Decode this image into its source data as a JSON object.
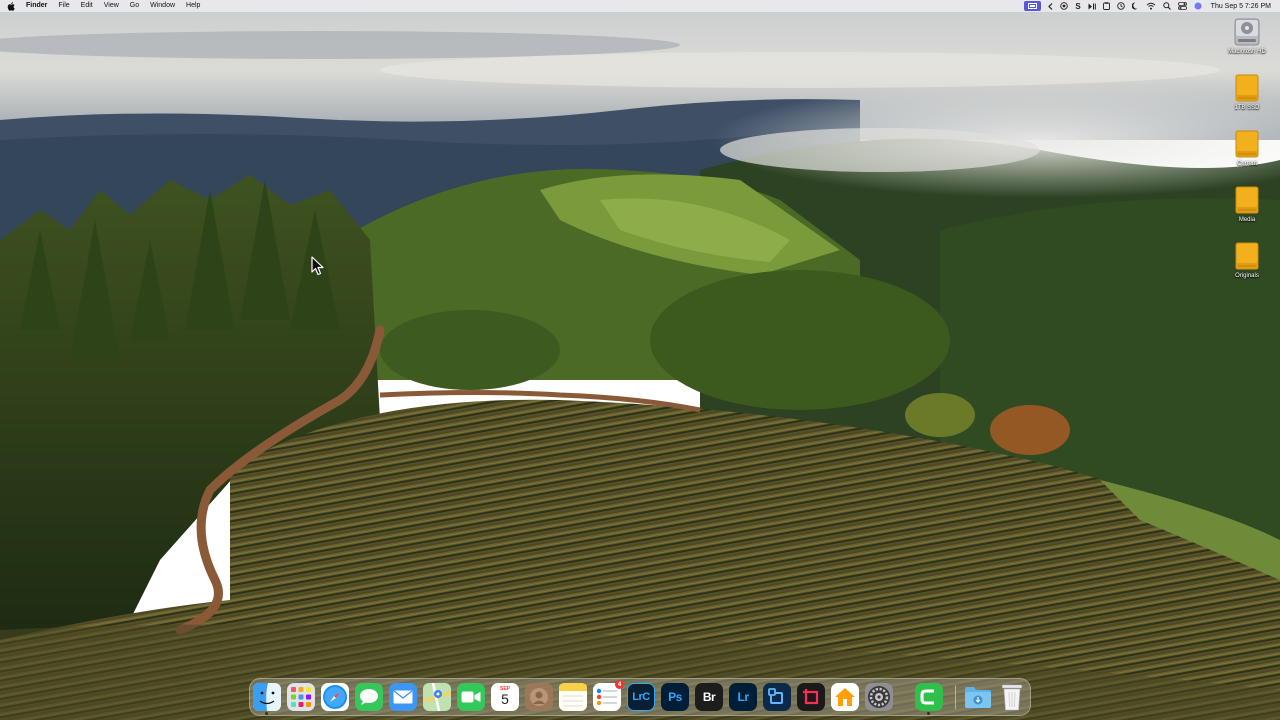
{
  "menubar": {
    "app_name": "Finder",
    "menus": [
      "File",
      "Edit",
      "View",
      "Go",
      "Window",
      "Help"
    ],
    "clock": "Thu Sep 5  7:26 PM",
    "tray_icons": [
      "screen-mirroring-icon",
      "back-chevron-icon",
      "record-icon",
      "skype-s-icon",
      "play-pause-icon",
      "clipboard-icon",
      "clock-history-icon",
      "focus-moon-icon",
      "wifi-icon",
      "search-icon",
      "control-center-icon",
      "siri-icon"
    ]
  },
  "desktop_icons": [
    {
      "label": "Macintosh HD",
      "icon": "hard-drive-icon"
    },
    {
      "label": "1TB SSD",
      "icon": "external-drive-icon"
    },
    {
      "label": "Current",
      "icon": "external-drive-icon"
    },
    {
      "label": "Media",
      "icon": "external-drive-icon"
    },
    {
      "label": "Originals",
      "icon": "external-drive-icon"
    }
  ],
  "dock": {
    "apps": [
      {
        "name": "Finder",
        "icon": "finder-icon"
      },
      {
        "name": "Launchpad",
        "icon": "launchpad-icon"
      },
      {
        "name": "Safari",
        "icon": "safari-icon"
      },
      {
        "name": "Messages",
        "icon": "messages-icon"
      },
      {
        "name": "Mail",
        "icon": "mail-icon"
      },
      {
        "name": "Maps",
        "icon": "maps-icon"
      },
      {
        "name": "FaceTime",
        "icon": "facetime-icon"
      },
      {
        "name": "Calendar",
        "icon": "calendar-icon",
        "month": "SEP",
        "day": "5"
      },
      {
        "name": "Contacts",
        "icon": "contacts-icon"
      },
      {
        "name": "Notes",
        "icon": "notes-icon"
      },
      {
        "name": "Reminders",
        "icon": "reminders-icon",
        "badge": "4"
      },
      {
        "name": "Lightroom Classic",
        "icon": "lightroom-classic-icon",
        "abbr": "LrC"
      },
      {
        "name": "Photoshop",
        "icon": "photoshop-icon",
        "abbr": "Ps"
      },
      {
        "name": "Bridge",
        "icon": "bridge-icon",
        "abbr": "Br"
      },
      {
        "name": "Lightroom",
        "icon": "lightroom-icon",
        "abbr": "Lr"
      },
      {
        "name": "Screenshot Utility",
        "icon": "screenshot-utility-icon"
      },
      {
        "name": "Red Utility",
        "icon": "red-crop-icon"
      },
      {
        "name": "Home",
        "icon": "home-icon"
      },
      {
        "name": "System Settings",
        "icon": "system-settings-icon"
      },
      {
        "name": "Camtasia",
        "icon": "camtasia-icon"
      },
      {
        "name": "Downloads",
        "icon": "downloads-folder-icon"
      },
      {
        "name": "Trash",
        "icon": "trash-icon"
      }
    ]
  },
  "colors": {
    "menubar_bg": "#ececf0",
    "tray_highlight": "#5a57d9",
    "drive_gold": "#f2b01c",
    "badge_red": "#e8382f",
    "photoshop_blue": "#31a8ff",
    "lightroom_blue": "#31a8ff",
    "bridge_white": "#ffffff"
  }
}
